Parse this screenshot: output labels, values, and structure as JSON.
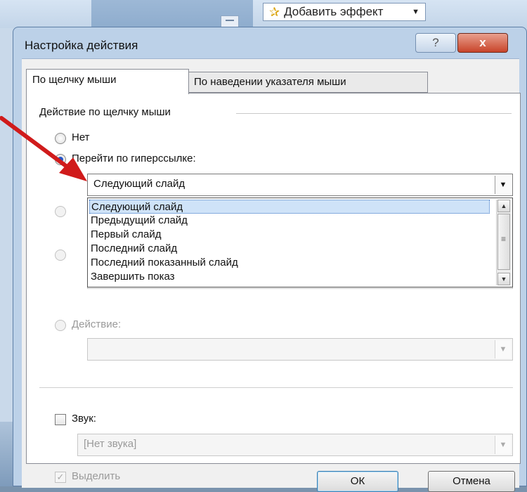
{
  "background_app": {
    "effect_button_label": "Добавить эффект"
  },
  "dialog": {
    "title": "Настройка действия",
    "help_label": "?",
    "close_label": "x",
    "tabs": [
      {
        "label": "По щелчку мыши",
        "active": true
      },
      {
        "label": "По наведении указателя мыши",
        "active": false
      }
    ],
    "group_label": "Действие по щелчку мыши",
    "options": {
      "none": "Нет",
      "hyperlink": "Перейти по гиперссылке:",
      "action": "Действие:"
    },
    "hyperlink_combo": {
      "selected": "Следующий слайд",
      "items": [
        "Следующий слайд",
        "Предыдущий слайд",
        "Первый слайд",
        "Последний слайд",
        "Последний показанный слайд",
        "Завершить показ"
      ]
    },
    "sound": {
      "label": "Звук:",
      "value": "[Нет звука]"
    },
    "highlight_label": "Выделить",
    "buttons": {
      "ok": "ОК",
      "cancel": "Отмена"
    }
  },
  "colors": {
    "accent": "#2456c8",
    "selection": "#cfe3f8",
    "close": "#c8442a",
    "arrow": "#d01b1b"
  }
}
